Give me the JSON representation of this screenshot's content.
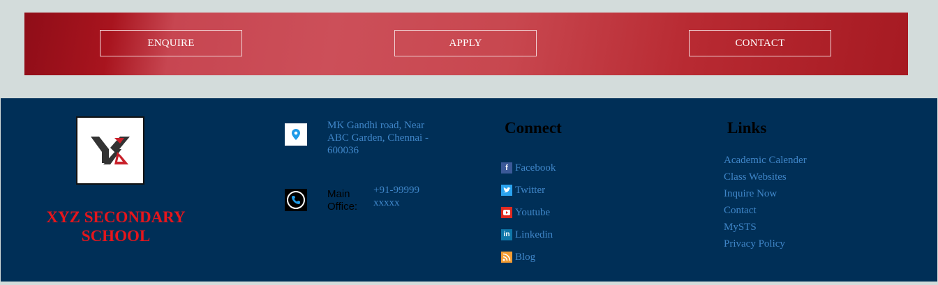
{
  "cta": {
    "enquire": "ENQUIRE",
    "apply": "APPLY",
    "contact": "CONTACT"
  },
  "school": {
    "name": "XYZ SECONDARY SCHOOL",
    "name_color": "#e5161c"
  },
  "contact_info": {
    "address": "MK Gandhi road, Near ABC Garden, Chennai - 600036",
    "office_label": "Main Office:",
    "phone": "+91-99999 xxxxx"
  },
  "connect": {
    "heading": "Connect",
    "items": [
      {
        "label": "Facebook",
        "icon": "facebook-icon",
        "color": "#3b5998"
      },
      {
        "label": "Twitter",
        "icon": "twitter-icon",
        "color": "#2aa3ef"
      },
      {
        "label": "Youtube",
        "icon": "youtube-icon",
        "color": "#e02a20"
      },
      {
        "label": "Linkedin",
        "icon": "linkedin-icon",
        "color": "#0e76a8"
      },
      {
        "label": "Blog",
        "icon": "rss-icon",
        "color": "#f39c32"
      }
    ]
  },
  "links": {
    "heading": "Links",
    "items": [
      "Academic Calender",
      "Class Websites",
      "Inquire Now",
      "Contact",
      "MySTS",
      "Privacy Policy"
    ]
  },
  "colors": {
    "footer_bg": "#002f57",
    "link": "#3f86c8",
    "banner_red": "#c74651"
  }
}
